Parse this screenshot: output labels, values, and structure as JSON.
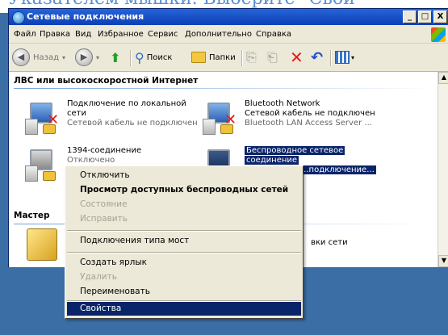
{
  "caption_text": "Указателем мышки. Выберите \"Свой",
  "window": {
    "title": "Сетевые подключения",
    "controls": [
      "_",
      "□",
      "X"
    ]
  },
  "menu": [
    "Файл",
    "Правка",
    "Вид",
    "Избранное",
    "Сервис",
    "Дополнительно",
    "Справка"
  ],
  "toolbar": {
    "back": "Назад",
    "search": "Поиск",
    "folders": "Папки"
  },
  "groups": {
    "lan": "ЛВС или высокоскоростной Интернет",
    "wizard": "Мастер"
  },
  "connections": [
    {
      "name": "Подключение по локальной",
      "line2": "сети",
      "status": "Сетевой кабель не подключен",
      "icon": "disconnected-lan-icon"
    },
    {
      "name": "Bluetooth Network",
      "line2": "Сетевой кабель не подключен",
      "status": "Bluetooth LAN Access Server ...",
      "icon": "disconnected-bluetooth-icon"
    },
    {
      "name": "1394-соединение",
      "line2": "Отключено",
      "status": "",
      "icon": "firewire-connection-icon"
    },
    {
      "name": "Беспроводное сетевое",
      "line2": "соединение",
      "status": "...подключение...",
      "icon": "wireless-connection-icon"
    }
  ],
  "wizard_text": "вки сети",
  "context_menu": {
    "items": [
      {
        "label": "Отключить",
        "enabled": true,
        "bold": false
      },
      {
        "label": "Просмотр доступных беспроводных сетей",
        "enabled": true,
        "bold": true
      },
      {
        "label": "Состояние",
        "enabled": false,
        "bold": false
      },
      {
        "label": "Исправить",
        "enabled": false,
        "bold": false
      },
      {
        "label": "Подключения типа мост",
        "enabled": true,
        "bold": false
      },
      {
        "label": "Создать ярлык",
        "enabled": true,
        "bold": false
      },
      {
        "label": "Удалить",
        "enabled": false,
        "bold": false
      },
      {
        "label": "Переименовать",
        "enabled": true,
        "bold": false
      },
      {
        "label": "Свойства",
        "enabled": true,
        "bold": false,
        "highlighted": true
      }
    ]
  },
  "colors": {
    "title_bar": "#0a3fb6",
    "selection": "#0a246a",
    "desktop": "#3a6ea5",
    "error_x": "#e31b1b"
  }
}
